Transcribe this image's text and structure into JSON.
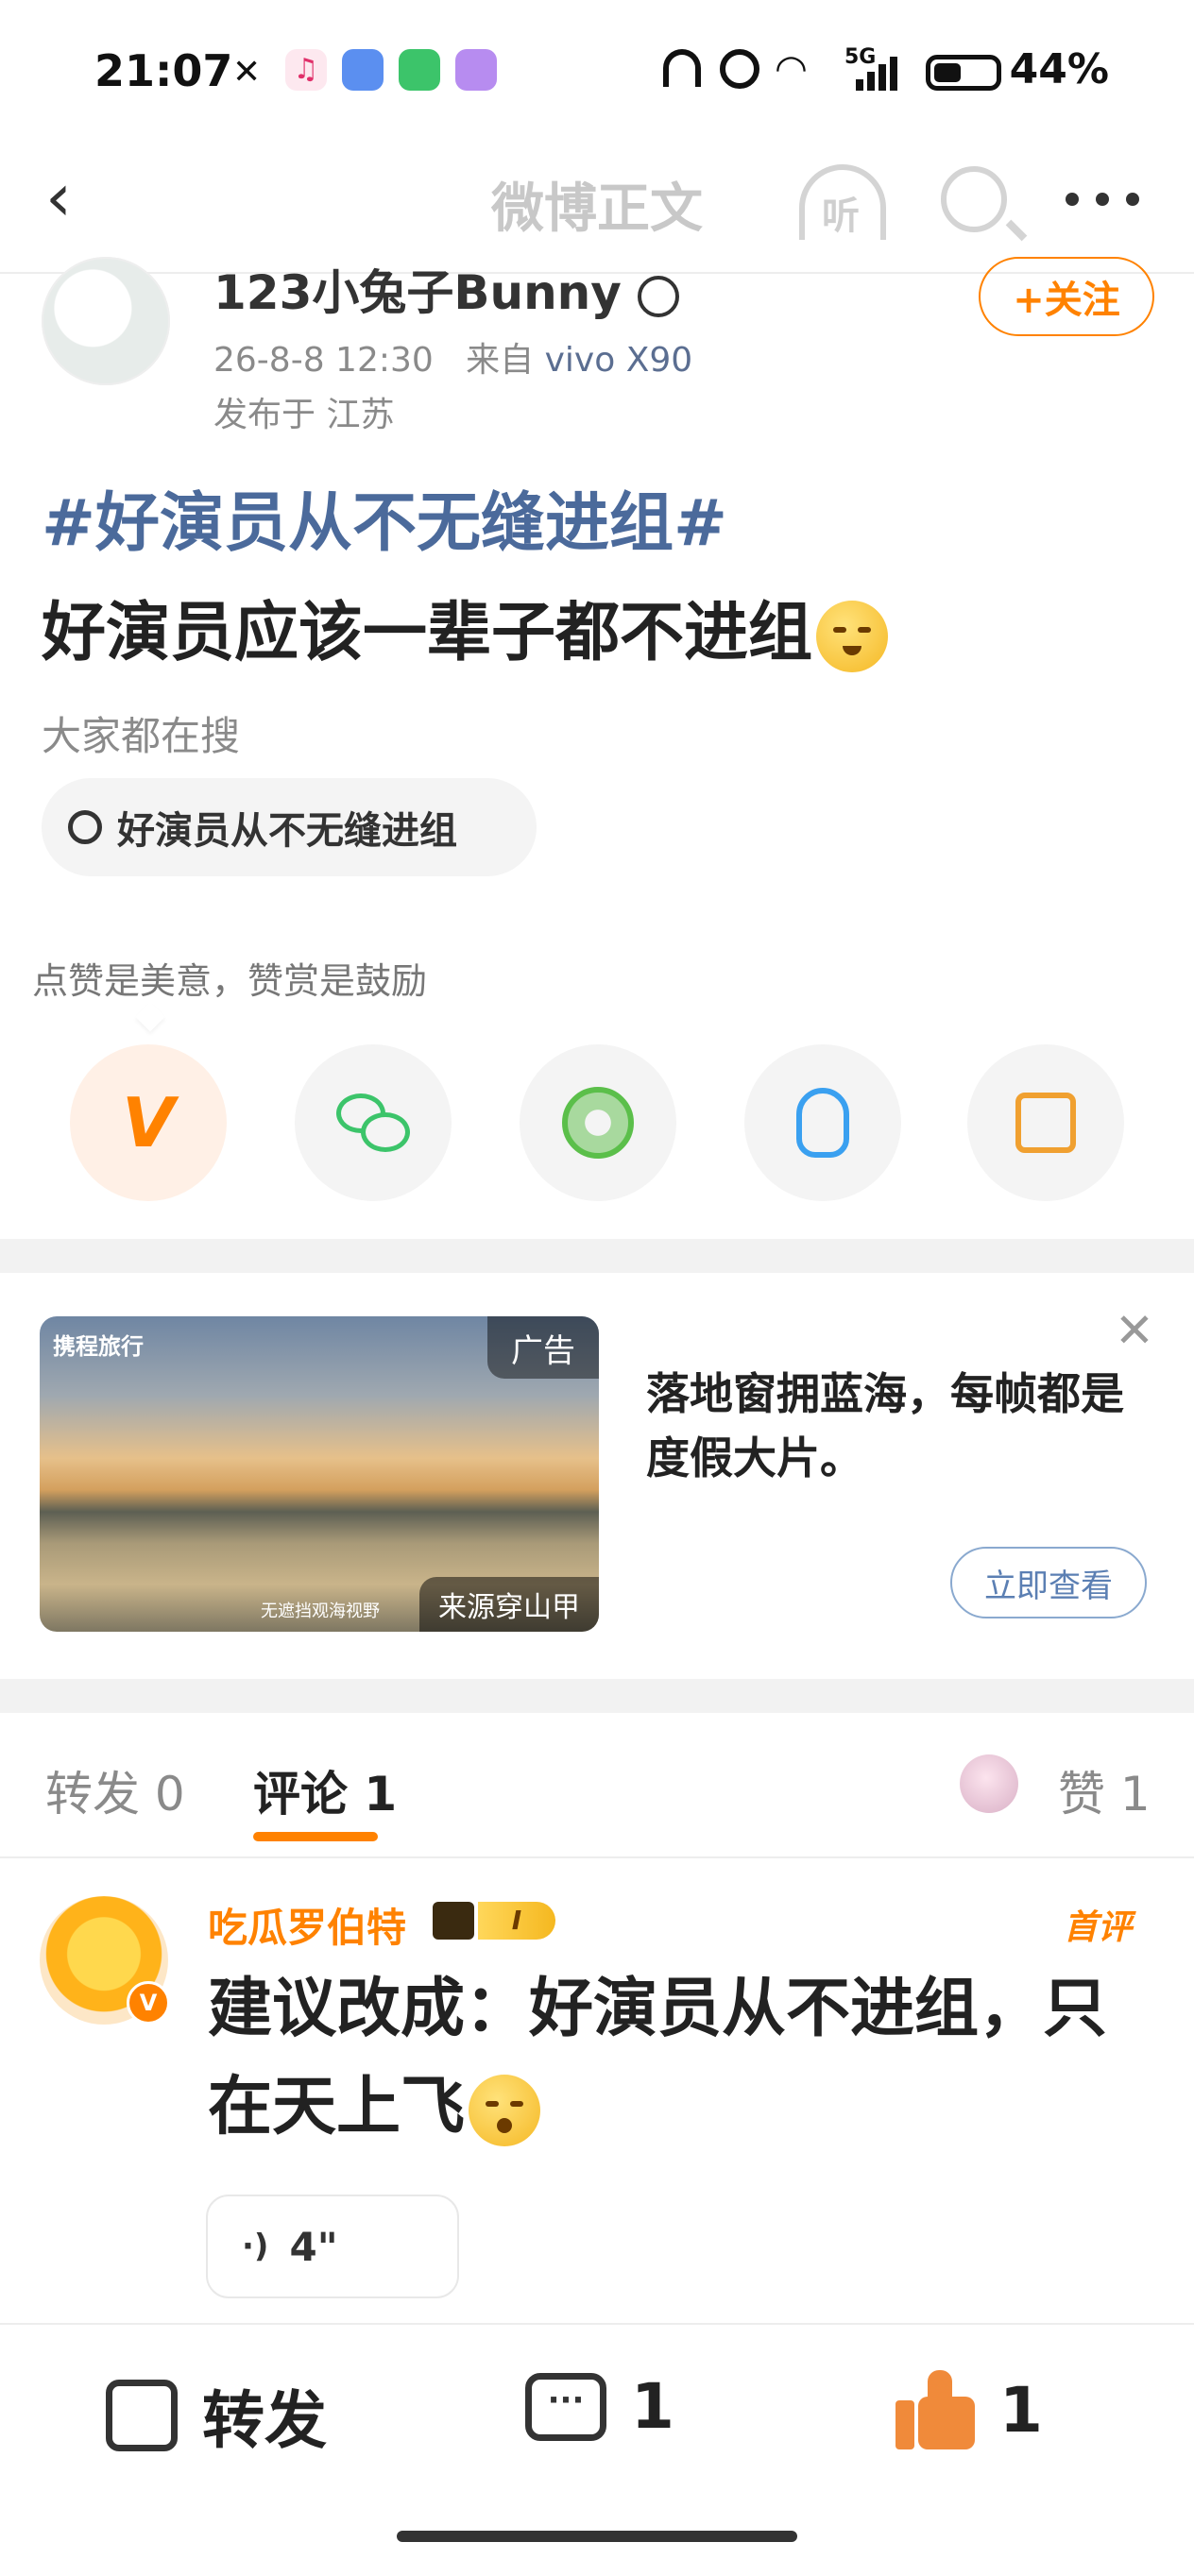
{
  "status_bar": {
    "time": "21:07",
    "network": "5G",
    "battery": "44%"
  },
  "nav": {
    "title": "微博正文"
  },
  "post": {
    "author": {
      "name": "123小兔子Bunny"
    },
    "time": "26-8-8 12:30",
    "source_prefix": "来自",
    "source_device": "vivo X90",
    "location": "发布于 江苏",
    "follow_label": "+关注",
    "hashtag": "#好演员从不无缝进组#",
    "text": "好演员应该一辈子都不进组"
  },
  "search_section": {
    "label": "大家都在搜",
    "pill": "好演员从不无缝进组"
  },
  "share": {
    "encourage_text": "点赞是美意，赞赏是鼓励",
    "buttons": [
      "v-plus-icon",
      "wechat-icon",
      "moments-icon",
      "qq-icon",
      "save-image-icon"
    ]
  },
  "ad": {
    "logo": "携程旅行",
    "badge": "广告",
    "caption": "无遮挡观海视野",
    "source": "来源穿山甲",
    "text": "落地窗拥蓝海，每帧都是度假大片。",
    "button": "立即查看"
  },
  "tabs": {
    "repost": "转发 0",
    "comment": "评论 1",
    "like": "赞 1"
  },
  "comment": {
    "author": "吃瓜罗伯特",
    "level": "I",
    "first_badge": "首评",
    "text": "建议改成：好演员从不进组，只在天上飞",
    "voice_duration": "4\""
  },
  "bottom_bar": {
    "repost_label": "转发",
    "comment_count": "1",
    "like_count": "1"
  },
  "colors": {
    "accent": "#ff8200",
    "hashtag": "#4b6a9b"
  }
}
